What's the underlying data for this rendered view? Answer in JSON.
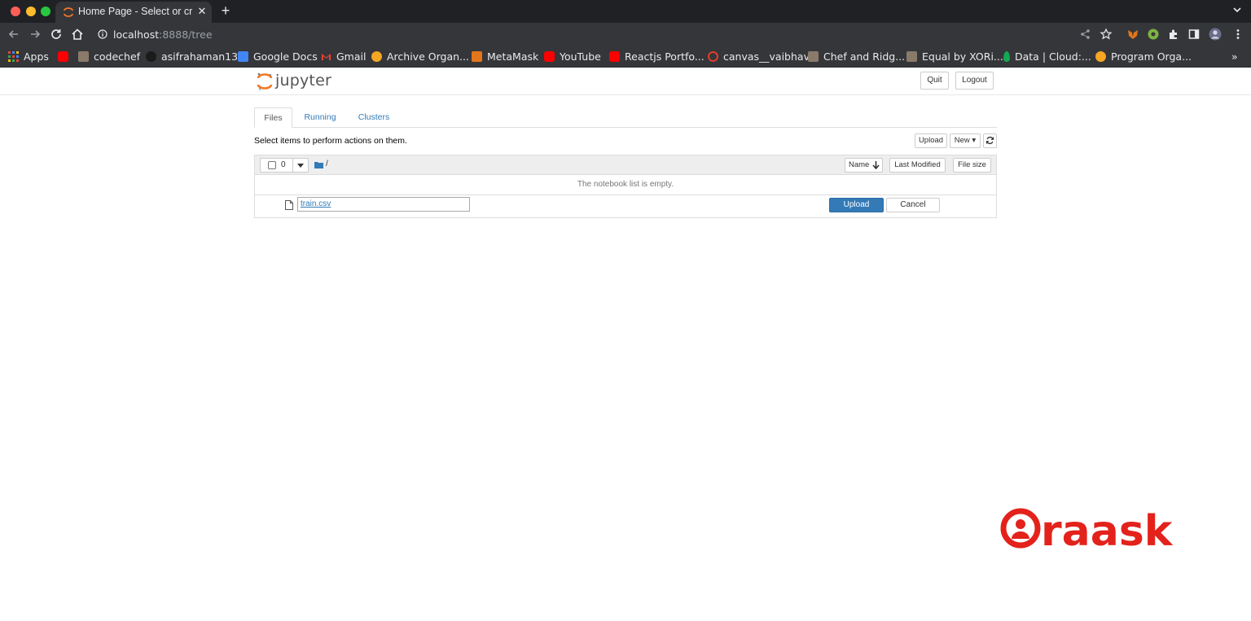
{
  "browser": {
    "tab_title": "Home Page - Select or cre",
    "url_host": "localhost",
    "url_path": ":8888/tree",
    "bookmarks": [
      {
        "label": "Apps",
        "icon": "apps-grid-icon",
        "color": "#e8eaed"
      },
      {
        "label": "",
        "icon": "youtube-icon",
        "color": "#ff0000"
      },
      {
        "label": "codechef",
        "icon": "codechef-icon",
        "color": "#8a7a6a"
      },
      {
        "label": "asifrahaman13",
        "icon": "github-icon",
        "color": "#222222"
      },
      {
        "label": "Google Docs",
        "icon": "google-docs-icon",
        "color": "#4285f4"
      },
      {
        "label": "Gmail",
        "icon": "gmail-icon",
        "color": "#ea4335"
      },
      {
        "label": "Archive Organ...",
        "icon": "archive-icon",
        "color": "#f5a623"
      },
      {
        "label": "MetaMask",
        "icon": "metamask-icon",
        "color": "#e2761b"
      },
      {
        "label": "YouTube",
        "icon": "youtube-icon",
        "color": "#ff0000"
      },
      {
        "label": "Reactjs Portfo...",
        "icon": "youtube-icon",
        "color": "#ff0000"
      },
      {
        "label": "canvas__vaibhav",
        "icon": "canvas-icon",
        "color": "#e13d2b"
      },
      {
        "label": "Chef and Ridg...",
        "icon": "codechef-icon",
        "color": "#8a7a6a"
      },
      {
        "label": "Equal by XORi...",
        "icon": "codechef-icon",
        "color": "#8a7a6a"
      },
      {
        "label": "Data | Cloud:...",
        "icon": "mongodb-icon",
        "color": "#13aa52"
      },
      {
        "label": "Program Orga...",
        "icon": "program-icon",
        "color": "#f5a623"
      }
    ],
    "more_label": "»"
  },
  "jupyter": {
    "logo_text": "jupyter",
    "quit_label": "Quit",
    "logout_label": "Logout",
    "tabs": [
      "Files",
      "Running",
      "Clusters"
    ],
    "active_tab": "Files",
    "select_text": "Select items to perform actions on them.",
    "upload_label": "Upload",
    "new_label": "New ▾",
    "selected_count": "0",
    "breadcrumb_path": "/",
    "col_name": "Name",
    "col_last_modified": "Last Modified",
    "col_file_size": "File size",
    "empty_text": "The notebook list is empty.",
    "upload_file": {
      "filename": "train.csv",
      "upload_label": "Upload",
      "cancel_label": "Cancel"
    }
  },
  "watermark": {
    "text": "raask",
    "color": "#e3221b"
  }
}
